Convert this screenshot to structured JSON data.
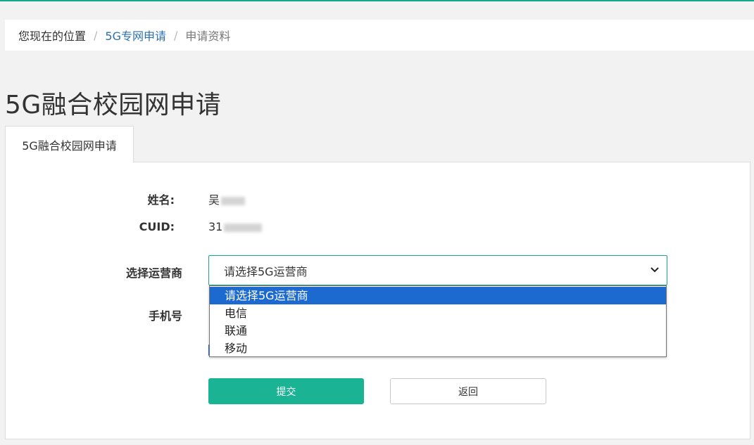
{
  "breadcrumb": {
    "home": "您现在的位置",
    "separator": "/",
    "link": "5G专网申请",
    "current": "申请资料"
  },
  "page_title": "5G融合校园网申请",
  "tab_label": "5G融合校园网申请",
  "form": {
    "name_label": "姓名:",
    "name_value": "吴",
    "cuid_label": "CUID:",
    "cuid_value": "31",
    "carrier_label": "选择运营商",
    "carrier_selected": "请选择5G运营商",
    "carrier_options": [
      "请选择5G运营商",
      "电信",
      "联通",
      "移动"
    ],
    "phone_label": "手机号"
  },
  "buttons": {
    "submit": "提交",
    "back": "返回"
  },
  "colors": {
    "accent": "#1ab394",
    "top_line": "#1aa68a",
    "link": "#2c6fad",
    "option_highlight": "#1c6ad0"
  },
  "icons": {
    "select_arrow": "chevron-down-icon"
  }
}
